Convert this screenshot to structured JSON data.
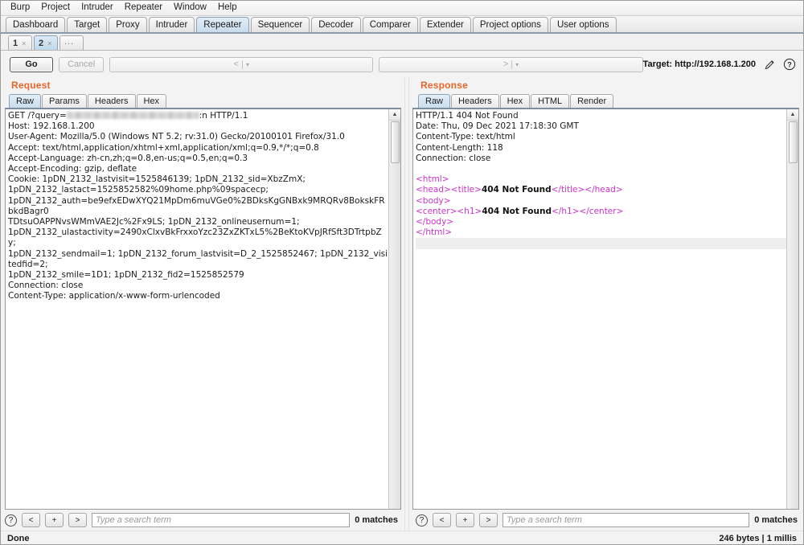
{
  "menu": {
    "items": [
      "Burp",
      "Project",
      "Intruder",
      "Repeater",
      "Window",
      "Help"
    ]
  },
  "main_tabs": {
    "items": [
      {
        "label": "Dashboard",
        "active": false
      },
      {
        "label": "Target",
        "active": false
      },
      {
        "label": "Proxy",
        "active": false
      },
      {
        "label": "Intruder",
        "active": false
      },
      {
        "label": "Repeater",
        "active": true
      },
      {
        "label": "Sequencer",
        "active": false
      },
      {
        "label": "Decoder",
        "active": false
      },
      {
        "label": "Comparer",
        "active": false
      },
      {
        "label": "Extender",
        "active": false
      },
      {
        "label": "Project options",
        "active": false
      },
      {
        "label": "User options",
        "active": false
      }
    ]
  },
  "repeater_tabs": {
    "items": [
      {
        "label": "1",
        "close": "×",
        "active": false
      },
      {
        "label": "2",
        "close": "×",
        "active": true
      }
    ],
    "more_label": "..."
  },
  "toolbar": {
    "go_label": "Go",
    "cancel_label": "Cancel",
    "back_label": "<",
    "back_caret": "▾",
    "forward_label": ">",
    "forward_caret": "▾",
    "separator": "|",
    "target_label": "Target: http://192.168.1.200",
    "edit_icon": "pencil-icon",
    "help_icon": "question-icon",
    "help_label": "?"
  },
  "request": {
    "title": "Request",
    "tabs": [
      {
        "label": "Raw",
        "active": true
      },
      {
        "label": "Params",
        "active": false
      },
      {
        "label": "Headers",
        "active": false
      },
      {
        "label": "Hex",
        "active": false
      }
    ],
    "lines": [
      {
        "pre": "GET /?query=",
        "redacted": true,
        "post": ":n HTTP/1.1"
      },
      {
        "pre": "Host: 192.168.1.200"
      },
      {
        "pre": "User-Agent: Mozilla/5.0 (Windows NT 5.2; rv:31.0) Gecko/20100101 Firefox/31.0"
      },
      {
        "pre": "Accept: text/html,application/xhtml+xml,application/xml;q=0.9,*/*;q=0.8"
      },
      {
        "pre": "Accept-Language: zh-cn,zh;q=0.8,en-us;q=0.5,en;q=0.3"
      },
      {
        "pre": "Accept-Encoding: gzip, deflate"
      },
      {
        "pre": "Cookie: 1pDN_2132_lastvisit=1525846139; 1pDN_2132_sid=XbzZmX;"
      },
      {
        "pre": "1pDN_2132_lastact=1525852582%09home.php%09spacecp;"
      },
      {
        "pre": "1pDN_2132_auth=be9efxEDwXYQ21MpDm6muVGe0%2BDksKgGNBxk9MRQRv8BokskFRbkdBagr0"
      },
      {
        "pre": "TDtsuOAPPNvsWMmVAE2Jc%2Fx9LS; 1pDN_2132_onlineusernum=1;"
      },
      {
        "pre": "1pDN_2132_ulastactivity=2490xClxvBkFrxxoYzc23ZxZKTxL5%2BeKtoKVpJRfSft3DTrtpbZy;"
      },
      {
        "pre": "1pDN_2132_sendmail=1; 1pDN_2132_forum_lastvisit=D_2_1525852467; 1pDN_2132_visitedfid=2;"
      },
      {
        "pre": "1pDN_2132_smile=1D1; 1pDN_2132_fid2=1525852579"
      },
      {
        "pre": "Connection: close"
      },
      {
        "pre": "Content-Type: application/x-www-form-urlencoded"
      }
    ],
    "search": {
      "help_label": "?",
      "prev_label": "<",
      "add_label": "+",
      "next_label": ">",
      "placeholder": "Type a search term",
      "value": "",
      "matches": "0 matches"
    }
  },
  "response": {
    "title": "Response",
    "tabs": [
      {
        "label": "Raw",
        "active": true
      },
      {
        "label": "Headers",
        "active": false
      },
      {
        "label": "Hex",
        "active": false
      },
      {
        "label": "HTML",
        "active": false
      },
      {
        "label": "Render",
        "active": false
      }
    ],
    "headers": [
      "HTTP/1.1 404 Not Found",
      "Date: Thu, 09 Dec 2021 17:18:30 GMT",
      "Content-Type: text/html",
      "Content-Length: 118",
      "Connection: close"
    ],
    "body": [
      [
        {
          "t": "tag",
          "v": "<html>"
        }
      ],
      [
        {
          "t": "tag",
          "v": "<head><title>"
        },
        {
          "t": "txt",
          "v": "404 Not Found"
        },
        {
          "t": "tag",
          "v": "</title></head>"
        }
      ],
      [
        {
          "t": "tag",
          "v": "<body>"
        }
      ],
      [
        {
          "t": "tag",
          "v": "<center><h1>"
        },
        {
          "t": "txt",
          "v": "404 Not Found"
        },
        {
          "t": "tag",
          "v": "</h1></center>"
        }
      ],
      [
        {
          "t": "tag",
          "v": "</body>"
        }
      ],
      [
        {
          "t": "tag",
          "v": "</html>"
        }
      ]
    ],
    "search": {
      "help_label": "?",
      "prev_label": "<",
      "add_label": "+",
      "next_label": ">",
      "placeholder": "Type a search term",
      "value": "",
      "matches": "0 matches"
    }
  },
  "statusbar": {
    "left": "Done",
    "right": "246 bytes | 1 millis"
  },
  "colors": {
    "accent_orange": "#e8652a",
    "tag_magenta": "#cc33cc",
    "active_tab_blue": "#cadcec"
  }
}
